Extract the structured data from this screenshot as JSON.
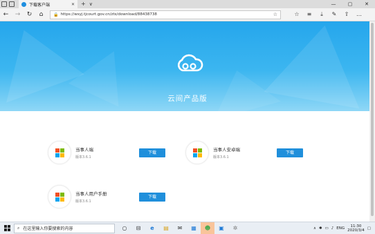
{
  "browser": {
    "tab_title": "下载客户端",
    "tab_close": "✕",
    "new_tab": "+",
    "tab_dropdown": "∨",
    "url": "https://wsyj.tjcourt.gov.cn/zts/download/88438738",
    "window_controls": [
      "—",
      "▢",
      "✕"
    ],
    "nav": [
      "←",
      "→",
      "↻",
      "⌂"
    ],
    "tools": [
      "☆",
      "≡",
      "⤓",
      "✎",
      "⇧",
      "…"
    ]
  },
  "hero": {
    "title": "云间产品版",
    "bg_color": "#2aa9ee"
  },
  "products": [
    {
      "name": "当事人端",
      "version": "版本3.6.1",
      "button": "下载"
    },
    {
      "name": "当事人安卓端",
      "version": "版本3.6.1",
      "button": "下载"
    },
    {
      "name": "当事人用户手册",
      "version": "版本3.6.1",
      "button": "下载"
    }
  ],
  "taskbar": {
    "search_placeholder": "在这里输入你要搜索的内容",
    "apps": [
      "○",
      "⊟",
      "e",
      "▤",
      "✉",
      "▦",
      "☻",
      "▣",
      "✲"
    ],
    "active_app_index": 6,
    "tray_language": "ENG",
    "time": "11:30",
    "date": "2020/3/4"
  },
  "colors": {
    "accent": "#1f8fdb",
    "win_red": "#f25022",
    "win_green": "#7fba00",
    "win_blue": "#00a4ef",
    "win_yellow": "#ffb900"
  }
}
